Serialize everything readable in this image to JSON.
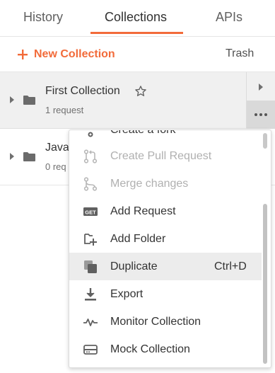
{
  "tabs": [
    {
      "label": "History"
    },
    {
      "label": "Collections"
    },
    {
      "label": "APIs"
    }
  ],
  "toolbar": {
    "new_collection": "New Collection",
    "trash": "Trash"
  },
  "collections": [
    {
      "name": "First Collection",
      "sub": "1 request"
    },
    {
      "name": "Java",
      "sub": "0 req"
    }
  ],
  "menu": {
    "partial_label": "Create a fork",
    "items": [
      {
        "label": "Create Pull Request",
        "icon": "pull-request-icon",
        "disabled": true
      },
      {
        "label": "Merge changes",
        "icon": "merge-icon",
        "disabled": true
      },
      {
        "label": "Add Request",
        "icon": "get-request-icon",
        "disabled": false
      },
      {
        "label": "Add Folder",
        "icon": "add-folder-icon",
        "disabled": false
      },
      {
        "label": "Duplicate",
        "icon": "duplicate-icon",
        "disabled": false,
        "shortcut": "Ctrl+D"
      },
      {
        "label": "Export",
        "icon": "export-icon",
        "disabled": false
      },
      {
        "label": "Monitor Collection",
        "icon": "monitor-icon",
        "disabled": false
      },
      {
        "label": "Mock Collection",
        "icon": "mock-icon",
        "disabled": false
      }
    ]
  },
  "get_badge": "GET",
  "colors": {
    "accent": "#f26b3a",
    "hover": "#ececec",
    "selected_row": "#f0f0f0"
  }
}
